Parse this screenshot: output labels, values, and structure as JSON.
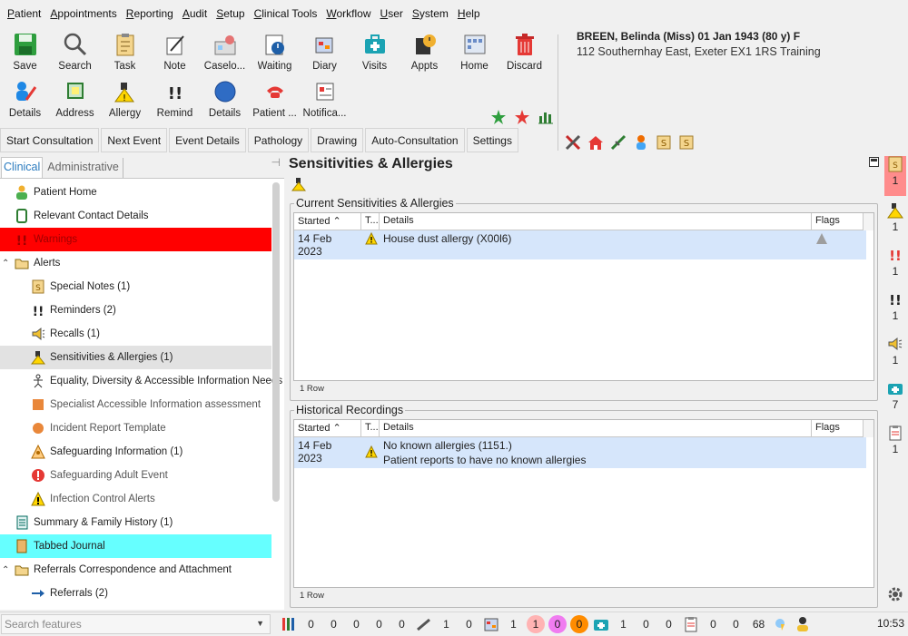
{
  "menu": [
    "Patient",
    "Appointments",
    "Reporting",
    "Audit",
    "Setup",
    "Clinical Tools",
    "Workflow",
    "User",
    "System",
    "Help"
  ],
  "toolbar": {
    "row1": [
      {
        "label": "Save",
        "icon": "save-icon"
      },
      {
        "label": "Search",
        "icon": "search-icon"
      },
      {
        "label": "Task",
        "icon": "task-icon"
      },
      {
        "label": "Note",
        "icon": "note-icon"
      },
      {
        "label": "Caselo...",
        "icon": "caseload-icon"
      },
      {
        "label": "Waiting",
        "icon": "waiting-icon"
      },
      {
        "label": "Diary",
        "icon": "diary-icon"
      },
      {
        "label": "Visits",
        "icon": "visits-icon"
      },
      {
        "label": "Appts",
        "icon": "appointments-icon"
      },
      {
        "label": "Home",
        "icon": "home-icon"
      },
      {
        "label": "Discard",
        "icon": "discard-icon"
      }
    ],
    "row2": [
      {
        "label": "Details",
        "icon": "details-icon"
      },
      {
        "label": "Address",
        "icon": "address-icon"
      },
      {
        "label": "Allergy",
        "icon": "allergy-icon"
      },
      {
        "label": "Remind",
        "icon": "remind-icon"
      },
      {
        "label": "Details",
        "icon": "circle-details-icon"
      },
      {
        "label": "Patient ...",
        "icon": "phone-icon"
      },
      {
        "label": "Notifica...",
        "icon": "notification-icon"
      }
    ]
  },
  "patient": {
    "name": "BREEN, Belinda (Miss) 01 Jan 1943 (80 y) F",
    "address": "112 Southernhay East, Exeter EX1 1RS  Training"
  },
  "tabs": [
    "Start Consultation",
    "Next Event",
    "Event Details",
    "Pathology",
    "Drawing",
    "Auto-Consultation",
    "Settings"
  ],
  "left_panel": {
    "tabs": [
      "Clinical",
      "Administrative"
    ],
    "tree": [
      {
        "label": "Patient Home",
        "icon": "person-icon"
      },
      {
        "label": "Relevant Contact Details",
        "icon": "mobile-icon"
      },
      {
        "label": "Warnings",
        "icon": "warning-exclaim-icon"
      },
      {
        "label": "Alerts",
        "icon": "folder-icon"
      },
      {
        "label": "Special Notes (1)",
        "icon": "special-notes-icon"
      },
      {
        "label": "Reminders (2)",
        "icon": "reminder-icon"
      },
      {
        "label": "Recalls (1)",
        "icon": "recall-icon"
      },
      {
        "label": "Sensitivities & Allergies (1)",
        "icon": "allergy-icon"
      },
      {
        "label": "Equality, Diversity & Accessible Information Needs",
        "icon": "stick-figure-icon"
      },
      {
        "label": "Specialist Accessible Information assessment",
        "icon": "orange-square-icon"
      },
      {
        "label": "Incident Report Template",
        "icon": "orange-circle-icon"
      },
      {
        "label": "Safeguarding Information (1)",
        "icon": "safeguarding-icon"
      },
      {
        "label": "Safeguarding Adult Event",
        "icon": "red-alert-icon"
      },
      {
        "label": "Infection Control Alerts",
        "icon": "warning-triangle-icon"
      },
      {
        "label": "Summary & Family History (1)",
        "icon": "summary-icon"
      },
      {
        "label": "Tabbed Journal",
        "icon": "journal-icon"
      },
      {
        "label": "Referrals Correspondence and Attachment",
        "icon": "folder-icon"
      },
      {
        "label": "Referrals (2)",
        "icon": "arrow-right-icon"
      }
    ]
  },
  "main": {
    "title": "Sensitivities & Allergies",
    "current": {
      "group_title": "Current Sensitivities & Allergies",
      "columns": [
        "Started",
        "T...",
        "Details",
        "Flags"
      ],
      "rows": [
        {
          "started": "14 Feb 2023",
          "details": "House dust allergy (X00l6)"
        }
      ],
      "row_count": "1 Row"
    },
    "historical": {
      "group_title": "Historical Recordings",
      "columns": [
        "Started",
        "T...",
        "Details",
        "Flags"
      ],
      "rows": [
        {
          "started": "14 Feb 2023",
          "details": "No known allergies (1151.)",
          "details2": "Patient reports to have no known allergies"
        }
      ],
      "row_count": "1 Row"
    }
  },
  "alert_bar": [
    "1",
    "1",
    "1",
    "1",
    "1",
    "7",
    "1"
  ],
  "status": {
    "search_placeholder": "Search features",
    "counts1": [
      "0",
      "0",
      "0",
      "0",
      "0"
    ],
    "counts2": [
      "1",
      "0"
    ],
    "counts3": [
      "1"
    ],
    "circles": [
      {
        "value": "1",
        "color": "#ffb3b3"
      },
      {
        "value": "0",
        "color": "#f07cf0"
      },
      {
        "value": "0",
        "color": "#ff8c00"
      }
    ],
    "counts4": [
      "1",
      "0",
      "0"
    ],
    "counts5": [
      "0",
      "0",
      "68"
    ],
    "time": "10:53"
  }
}
